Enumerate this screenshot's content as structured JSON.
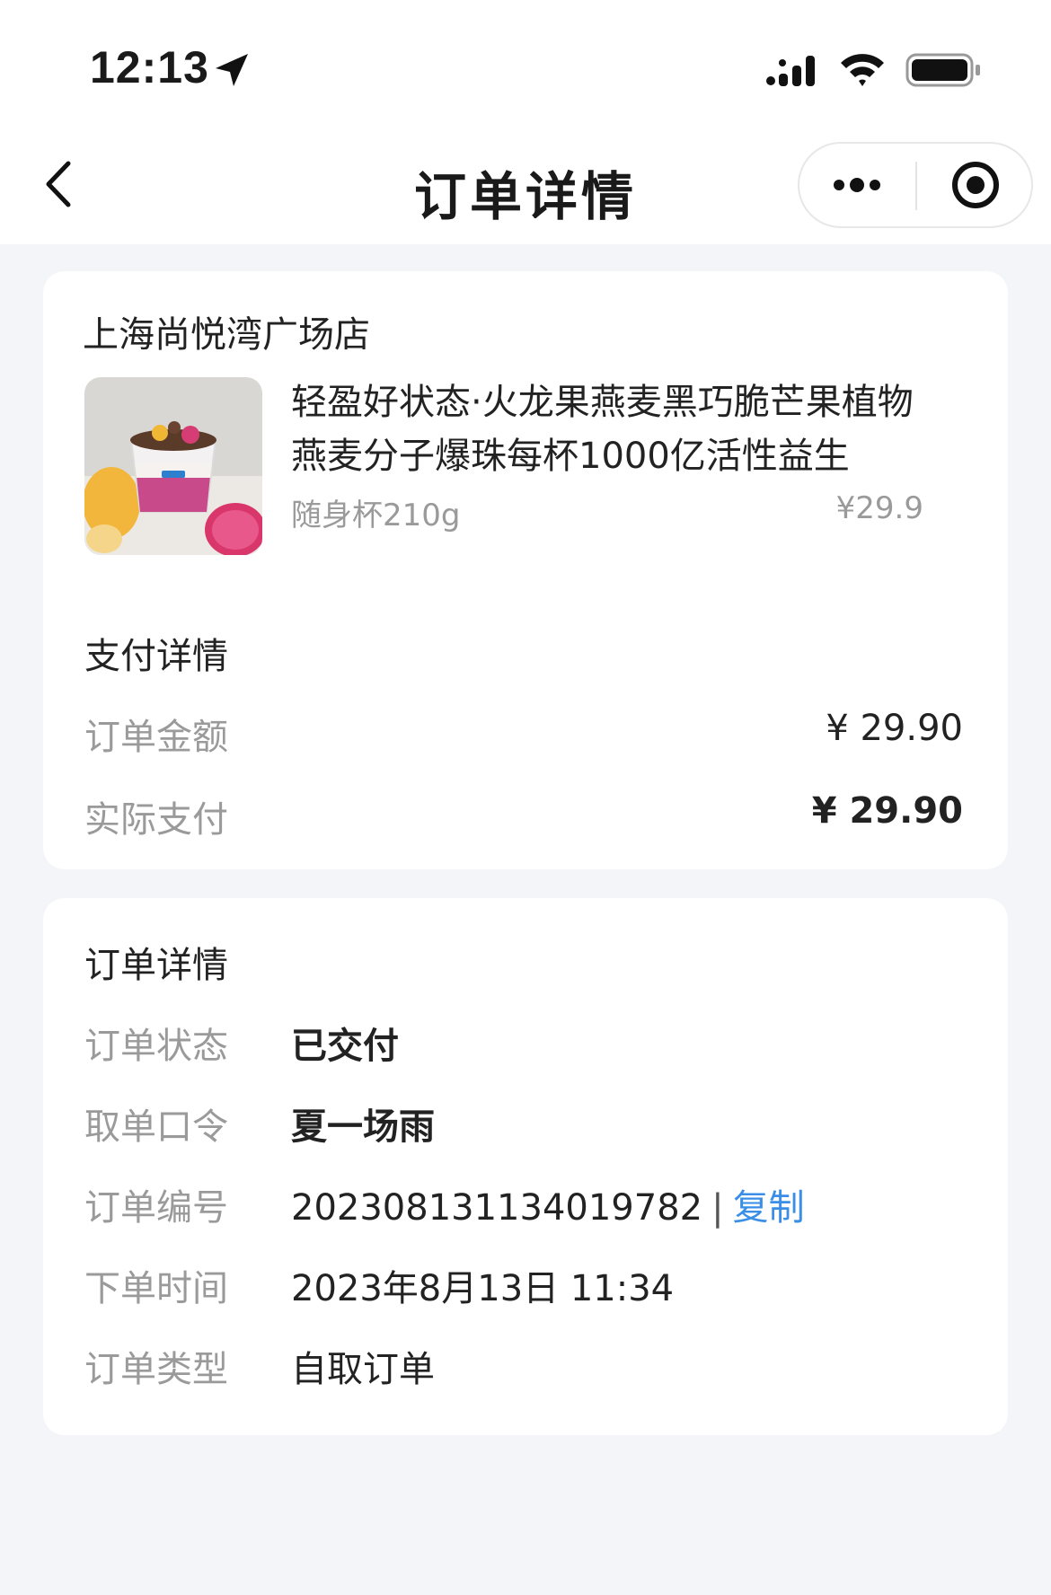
{
  "status_bar": {
    "time": "12:13",
    "icons": [
      "location-arrow-icon",
      "signal-icon",
      "wifi-icon",
      "battery-icon"
    ]
  },
  "nav": {
    "title": "订单详情",
    "back_icon": "chevron-left-icon",
    "more_icon": "more-dots-icon",
    "close_icon": "target-close-icon"
  },
  "order": {
    "store_name": "上海尚悦湾广场店",
    "product": {
      "name": "轻盈好状态·火龙果燕麦黑巧脆芒果植物燕麦分子爆珠每杯1000亿活性益生",
      "spec": "随身杯210g",
      "price": "¥29.9",
      "image": "yogurt-cup-image"
    }
  },
  "payment": {
    "title": "支付详情",
    "amount_label": "订单金额",
    "amount_value": "¥ 29.90",
    "paid_label": "实际支付",
    "paid_value": "¥ 29.90"
  },
  "details": {
    "title": "订单详情",
    "status_label": "订单状态",
    "status_value": "已交付",
    "pickup_label": "取单口令",
    "pickup_value": "夏一场雨",
    "number_label": "订单编号",
    "number_value": "2023081311340197​82",
    "separator": "|",
    "copy_label": "复制",
    "time_label": "下单时间",
    "time_value": "2023年8月13日 11:34",
    "type_label": "订单类型",
    "type_value": "自取订单"
  },
  "colors": {
    "background": "#f4f5f8",
    "card": "#ffffff",
    "link": "#3a8ee6",
    "muted": "#9a9a9a"
  }
}
